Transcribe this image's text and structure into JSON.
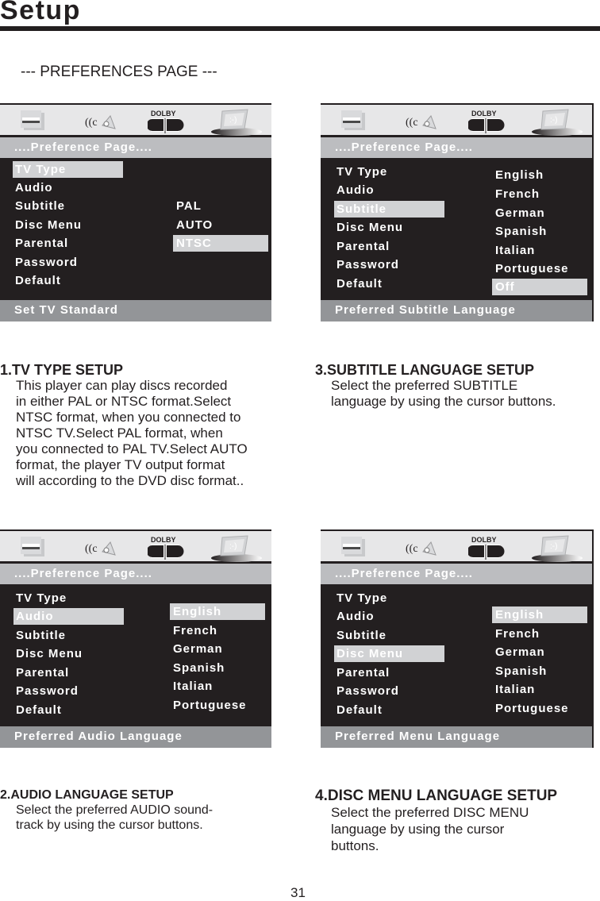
{
  "header": {
    "title": "Setup",
    "section": "--- PREFERENCES PAGE ---"
  },
  "icons": [
    "system-setup-icon",
    "audio-speaker-icon",
    "dolby-logo-icon",
    "preference-monitor-icon"
  ],
  "dolby_label": "DOLBY",
  "panels": [
    {
      "band": "....Preference Page....",
      "menu": [
        "TV Type",
        "Audio",
        "Subtitle",
        "Disc Menu",
        "Parental",
        "Password",
        "Default"
      ],
      "selected_menu": "TV Type",
      "options": [
        "PAL",
        "AUTO",
        "NTSC"
      ],
      "selected_option": "NTSC",
      "footer": "Set TV Standard"
    },
    {
      "band": "....Preference Page....",
      "menu": [
        "TV Type",
        "Audio",
        "Subtitle",
        "Disc Menu",
        "Parental",
        "Password",
        "Default"
      ],
      "selected_menu": "Subtitle",
      "options": [
        "English",
        "French",
        "German",
        "Spanish",
        "Italian",
        "Portuguese",
        "Off"
      ],
      "selected_option": "Off",
      "footer": "Preferred Subtitle Language"
    },
    {
      "band": "....Preference Page....",
      "menu": [
        "TV Type",
        "Audio",
        "Subtitle",
        "Disc Menu",
        "Parental",
        "Password",
        "Default"
      ],
      "selected_menu": "Audio",
      "options": [
        "English",
        "French",
        "German",
        "Spanish",
        "Italian",
        "Portuguese"
      ],
      "selected_option": "English",
      "footer": "Preferred Audio Language"
    },
    {
      "band": "....Preference Page....",
      "menu": [
        "TV Type",
        "Audio",
        "Subtitle",
        "Disc Menu",
        "Parental",
        "Password",
        "Default"
      ],
      "selected_menu": "Disc Menu",
      "options": [
        "English",
        "French",
        "German",
        "Spanish",
        "Italian",
        "Portuguese"
      ],
      "selected_option": "English",
      "footer": "Preferred Menu Language"
    }
  ],
  "descriptions": {
    "tv_type": {
      "heading": "1.TV TYPE SETUP",
      "lines": [
        "This player can play discs recorded",
        "in either PAL or NTSC format.Select",
        "NTSC format, when you connected to",
        "NTSC TV.Select PAL format, when",
        "you connected to PAL TV.Select AUTO",
        "format, the player TV output format",
        "will according to the DVD disc format.."
      ]
    },
    "subtitle": {
      "heading": "3.SUBTITLE LANGUAGE SETUP",
      "lines": [
        "Select the preferred SUBTITLE",
        "language by using the cursor buttons."
      ]
    },
    "audio": {
      "heading": "2.AUDIO LANGUAGE SETUP",
      "lines": [
        "Select the preferred AUDIO sound-",
        "track by using the cursor buttons."
      ]
    },
    "disc_menu": {
      "heading": "4.DISC MENU LANGUAGE SETUP",
      "lines": [
        "Select the preferred DISC MENU",
        "language by using the cursor",
        "buttons."
      ]
    }
  },
  "page_number": "31"
}
